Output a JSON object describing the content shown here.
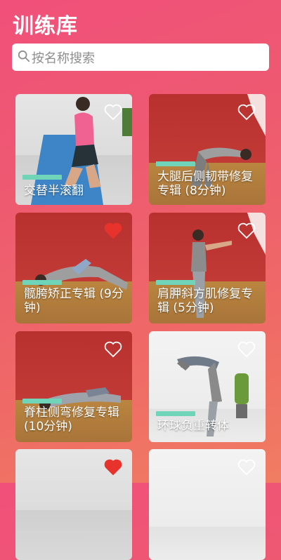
{
  "header": {
    "title": "训练库"
  },
  "search": {
    "placeholder": "按名称搜索"
  },
  "cards": [
    {
      "label": "交替半滚翻",
      "liked": false
    },
    {
      "label": "大腿后侧韧带修复专辑 (8分钟)",
      "liked": false
    },
    {
      "label": "髋胯矫正专辑 (9分钟)",
      "liked": true
    },
    {
      "label": "肩胛斜方肌修复专辑 (5分钟)",
      "liked": false
    },
    {
      "label": "脊柱侧弯修复专辑 (10分钟)",
      "liked": false
    },
    {
      "label": "环球负重转体",
      "liked": false
    },
    {
      "label": "",
      "liked": true
    },
    {
      "label": "",
      "liked": false
    }
  ],
  "colors": {
    "accent_bar": "#6fd4b8",
    "heart_liked": "#e8322c",
    "heart_outline": "#ffffff"
  }
}
